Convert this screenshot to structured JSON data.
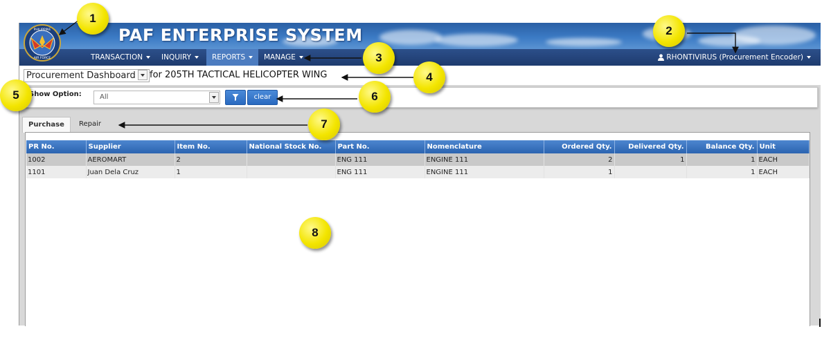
{
  "app": {
    "title": "PAF ENTERPRISE SYSTEM",
    "logo_text_top": "PHILIPPINE",
    "logo_text_bottom": "AIR FORCE"
  },
  "nav": {
    "items": [
      {
        "label": "TRANSACTION"
      },
      {
        "label": "INQUIRY"
      },
      {
        "label": "REPORTS"
      },
      {
        "label": "MANAGE"
      }
    ],
    "active": "REPORTS",
    "user_label": "RHONTIVIRUS (Procurement Encoder)"
  },
  "dashboard": {
    "selected": "Procurement Dashboard",
    "unit_text": "for 205TH TACTICAL HELICOPTER WING"
  },
  "filter": {
    "label": "Show Option:",
    "selected": "All",
    "clear_label": "clear",
    "filter_icon": "filter-icon"
  },
  "tabs": [
    {
      "label": "Purchase"
    },
    {
      "label": "Repair"
    }
  ],
  "table": {
    "columns": [
      "PR No.",
      "Supplier",
      "Item No.",
      "National Stock No.",
      "Part No.",
      "Nomenclature",
      "Ordered Qty.",
      "Delivered Qty.",
      "Balance Qty.",
      "Unit"
    ],
    "rows": [
      [
        "1002",
        "AEROMART",
        "2",
        "",
        "ENG 111",
        "ENGINE 111",
        "2",
        "1",
        "1",
        "EACH"
      ],
      [
        "1101",
        "Juan Dela Cruz",
        "1",
        "",
        "ENG 111",
        "ENGINE 111",
        "1",
        "",
        "1",
        "EACH"
      ]
    ]
  },
  "callouts": [
    "1",
    "2",
    "3",
    "4",
    "5",
    "6",
    "7",
    "8"
  ],
  "colors": {
    "banner": "#3b7ac4",
    "navbar": "#1e3b6e",
    "active_nav": "#4c7cc0",
    "header": "#2b64b0",
    "badge": "#f3e500"
  }
}
